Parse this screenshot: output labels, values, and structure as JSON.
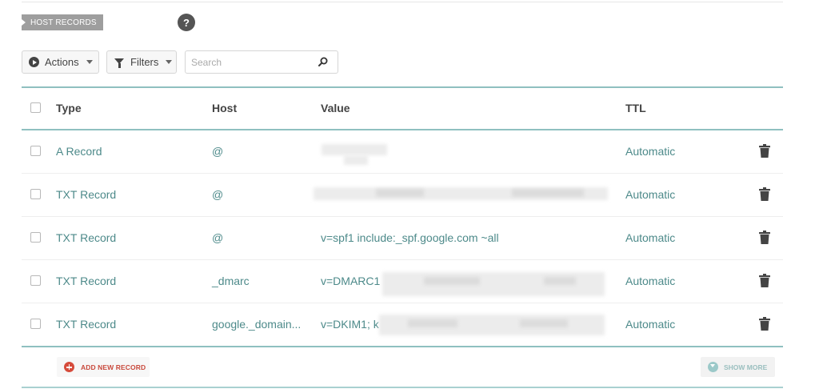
{
  "section": {
    "title": "HOST RECORDS",
    "help_label": "?"
  },
  "toolbar": {
    "actions_label": "Actions",
    "filters_label": "Filters",
    "search_placeholder": "Search"
  },
  "table": {
    "columns": [
      "Type",
      "Host",
      "Value",
      "TTL"
    ],
    "rows": [
      {
        "type": "A Record",
        "host": "@",
        "value": "",
        "ttl": "Automatic"
      },
      {
        "type": "TXT Record",
        "host": "@",
        "value": "",
        "ttl": "Automatic"
      },
      {
        "type": "TXT Record",
        "host": "@",
        "value": "v=spf1 include:_spf.google.com ~all",
        "ttl": "Automatic"
      },
      {
        "type": "TXT Record",
        "host": "_dmarc",
        "value": "v=DMARC1",
        "ttl": "Automatic"
      },
      {
        "type": "TXT Record",
        "host": "google._domain...",
        "value": "v=DKIM1; k",
        "ttl": "Automatic"
      }
    ]
  },
  "footer": {
    "add_label": "ADD NEW RECORD",
    "show_more_label": "SHOW MORE"
  },
  "colors": {
    "accent_teal": "#4d8a8a",
    "table_rule": "#8fc0c0",
    "add_red": "#d64b3b"
  },
  "icons": [
    "play-circle-icon",
    "filter-icon",
    "search-icon",
    "trash-icon",
    "plus-circle-icon",
    "chevron-circle-icon"
  ]
}
